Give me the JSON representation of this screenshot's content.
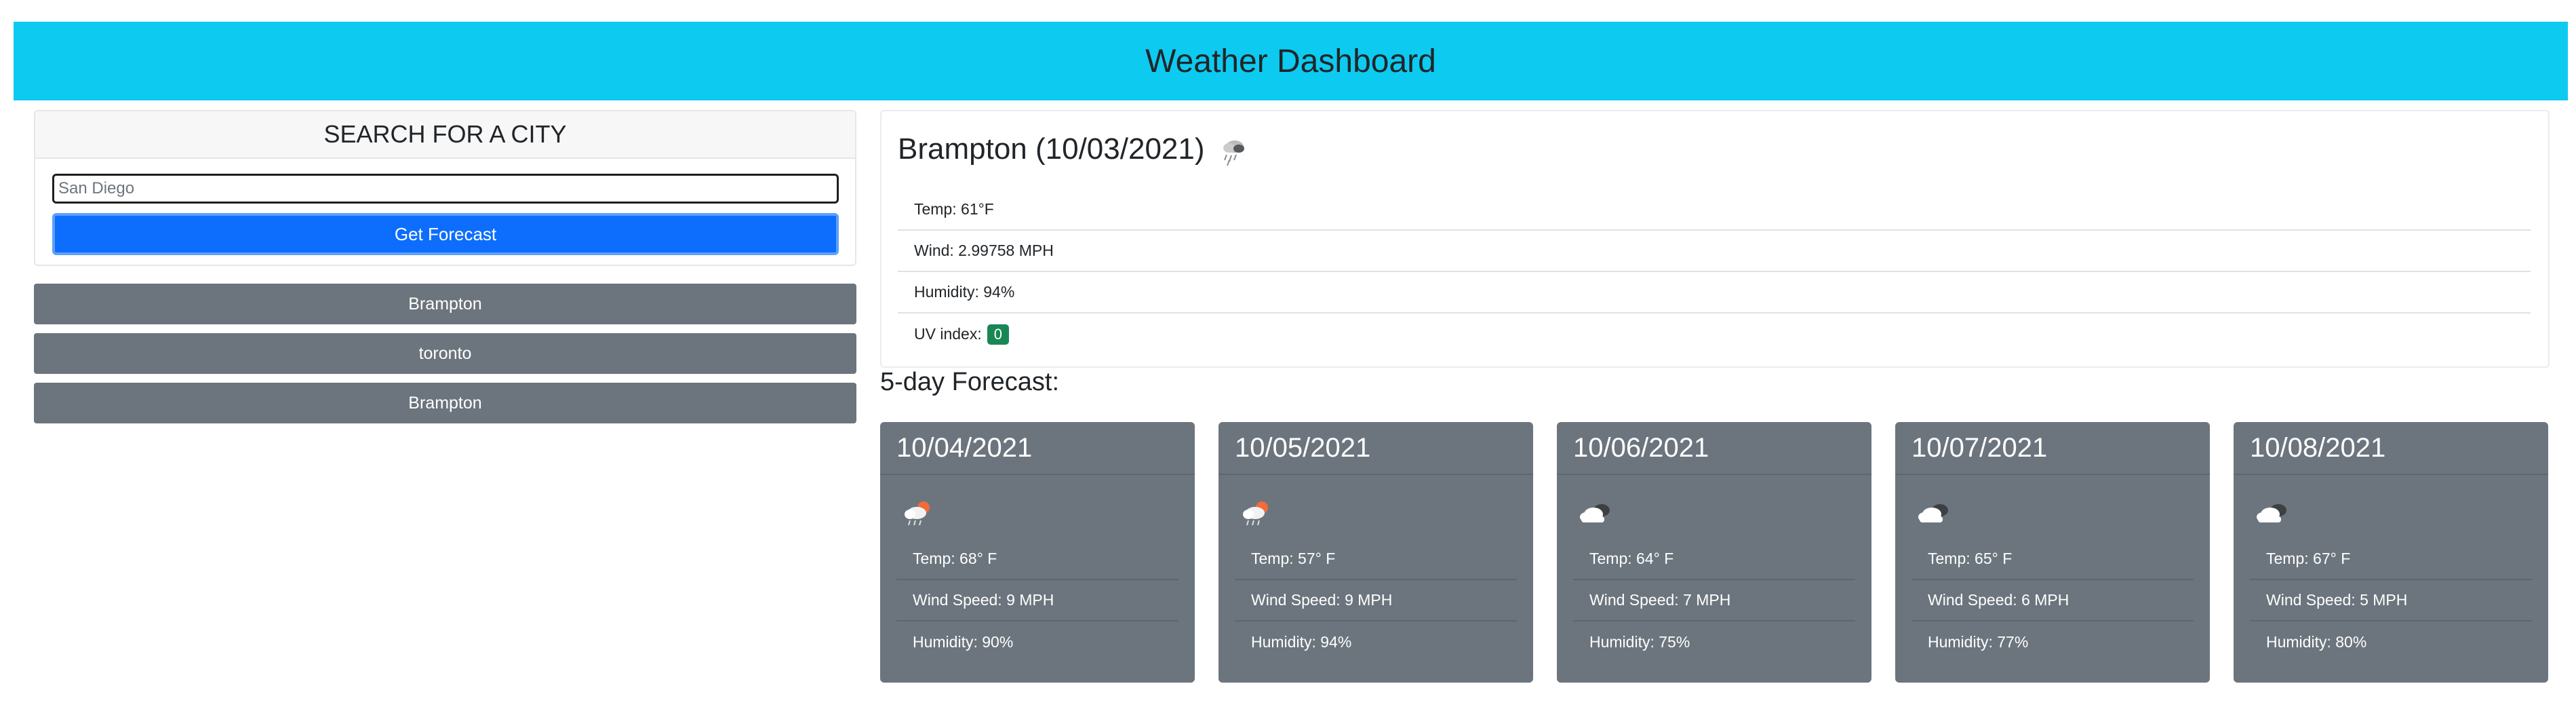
{
  "header": {
    "title": "Weather Dashboard"
  },
  "search": {
    "heading": "SEARCH FOR A CITY",
    "placeholder": "San Diego",
    "button_label": "Get Forecast"
  },
  "history": [
    "Brampton",
    "toronto",
    "Brampton"
  ],
  "current": {
    "title": "Brampton (10/03/2021)",
    "icon": "rain-icon",
    "temp": "Temp: 61°F",
    "wind": "Wind: 2.99758 MPH",
    "humidity": "Humidity: 94%",
    "uv_label": "UV index:",
    "uv_value": "0",
    "uv_color": "#198754"
  },
  "forecast_heading": "5-day Forecast:",
  "forecast": [
    {
      "date": "10/04/2021",
      "icon": "sun-rain-cloud-icon",
      "temp": "Temp: 68° F",
      "wind": "Wind Speed: 9 MPH",
      "humidity": "Humidity: 90%"
    },
    {
      "date": "10/05/2021",
      "icon": "sun-rain-cloud-icon",
      "temp": "Temp: 57° F",
      "wind": "Wind Speed: 9 MPH",
      "humidity": "Humidity: 94%"
    },
    {
      "date": "10/06/2021",
      "icon": "cloudy-icon",
      "temp": "Temp: 64° F",
      "wind": "Wind Speed: 7 MPH",
      "humidity": "Humidity: 75%"
    },
    {
      "date": "10/07/2021",
      "icon": "cloudy-icon",
      "temp": "Temp: 65° F",
      "wind": "Wind Speed: 6 MPH",
      "humidity": "Humidity: 77%"
    },
    {
      "date": "10/08/2021",
      "icon": "cloudy-icon",
      "temp": "Temp: 67° F",
      "wind": "Wind Speed: 5 MPH",
      "humidity": "Humidity: 80%"
    }
  ],
  "colors": {
    "header_bg": "#0dcaf0",
    "primary": "#0d6efd",
    "secondary": "#6c757d",
    "success": "#198754"
  }
}
